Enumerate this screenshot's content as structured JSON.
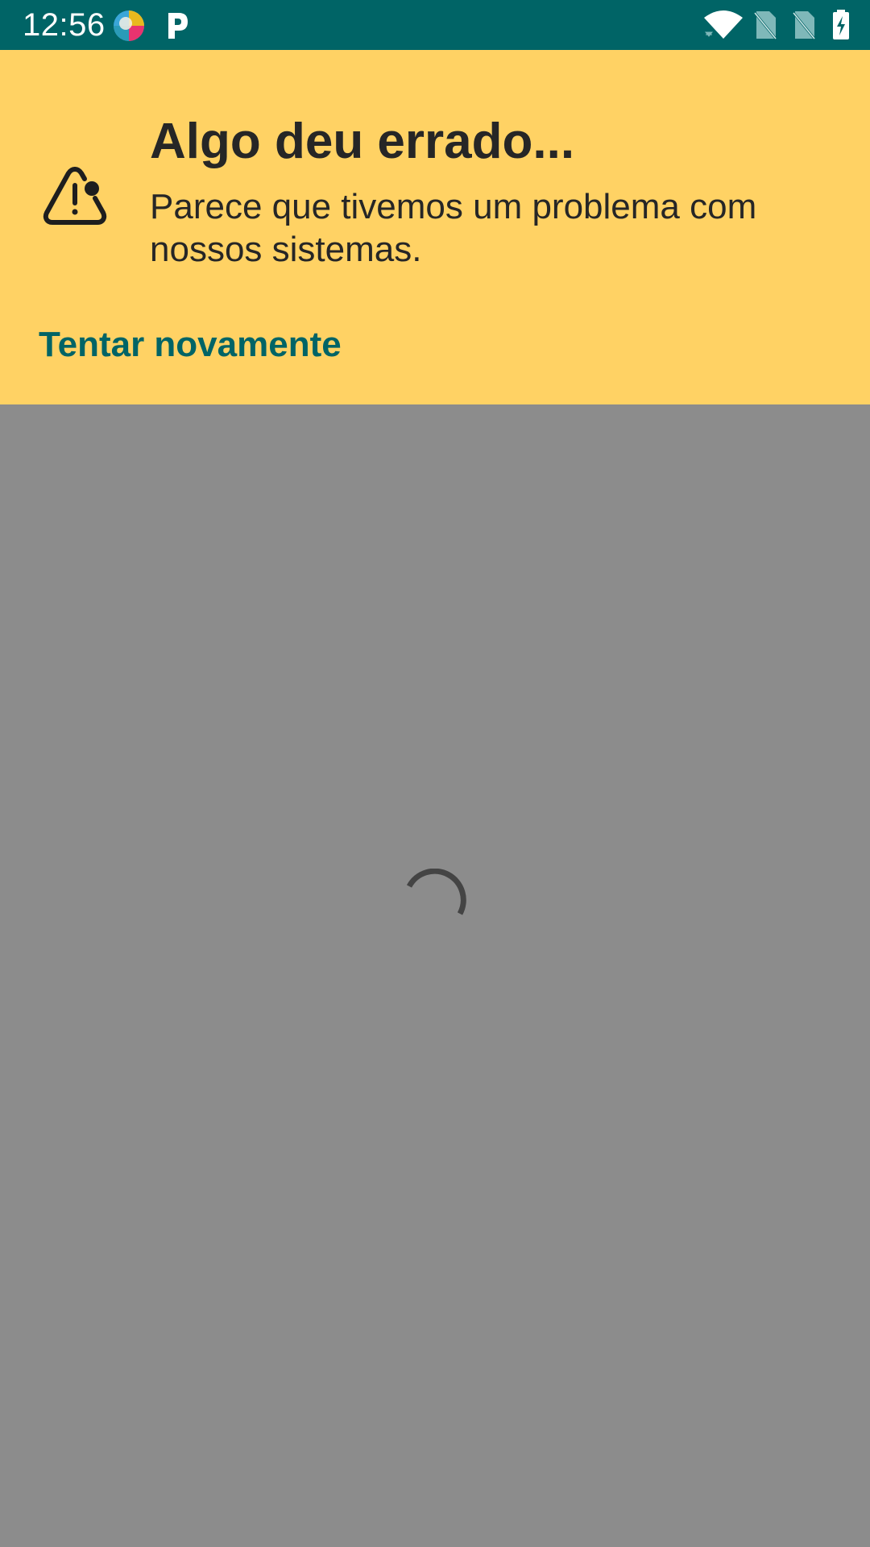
{
  "status_bar": {
    "time": "12:56",
    "background_color": "#006466",
    "notification_icons": [
      "colorful-app-icon",
      "p-app-icon"
    ],
    "system_icons": [
      "wifi-icon",
      "no-sim-icon",
      "no-sim-icon",
      "battery-charging-icon"
    ]
  },
  "error_banner": {
    "title": "Algo deu errado...",
    "message": "Parece que tivemos um problema com nossos sistemas.",
    "retry_label": "Tentar novamente",
    "background_color": "#ffd264",
    "accent_color": "#006466",
    "icon": "warning-icon"
  },
  "content": {
    "state": "loading",
    "indicator_icon": "loading-spinner-icon",
    "background_color": "#8c8c8c"
  }
}
